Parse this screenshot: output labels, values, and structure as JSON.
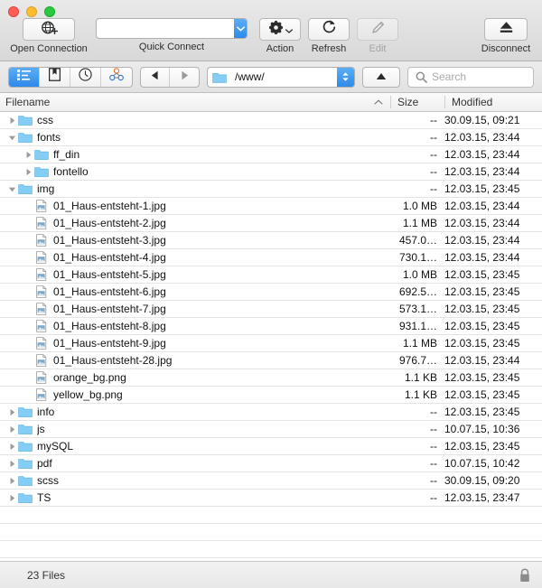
{
  "window": {
    "traffic_lights": [
      "close",
      "minimize",
      "zoom"
    ]
  },
  "toolbar": {
    "open_connection": {
      "label": "Open Connection",
      "icon": "globe-plus-icon"
    },
    "quick_connect": {
      "label": "Quick Connect",
      "value": "",
      "placeholder": "",
      "icon": "chevron-down-icon"
    },
    "action": {
      "label": "Action",
      "icon": "gear-icon"
    },
    "refresh": {
      "label": "Refresh",
      "icon": "refresh-icon"
    },
    "edit": {
      "label": "Edit",
      "icon": "pencil-icon",
      "disabled": true
    },
    "disconnect": {
      "label": "Disconnect",
      "icon": "eject-icon"
    }
  },
  "navbar": {
    "segments": [
      {
        "name": "browser-view",
        "icon": "list-view-icon",
        "selected": true
      },
      {
        "name": "bookmarks",
        "icon": "bookmark-icon",
        "selected": false
      },
      {
        "name": "history",
        "icon": "clock-icon",
        "selected": false
      },
      {
        "name": "bonjour",
        "icon": "bonjour-icon",
        "selected": false
      }
    ],
    "back": {
      "icon": "triangle-left-icon"
    },
    "forward": {
      "icon": "triangle-right-icon"
    },
    "path": {
      "value": "/www/",
      "icon": "folder-icon"
    },
    "up": {
      "icon": "triangle-up-icon"
    },
    "search": {
      "placeholder": "Search",
      "value": "",
      "icon": "search-icon"
    }
  },
  "columns": {
    "filename": "Filename",
    "size": "Size",
    "modified": "Modified",
    "sort_indicator": "▲"
  },
  "files": [
    {
      "name": "css",
      "type": "folder",
      "indent": 0,
      "expanded": false,
      "size": "--",
      "modified": "30.09.15, 09:21"
    },
    {
      "name": "fonts",
      "type": "folder",
      "indent": 0,
      "expanded": true,
      "size": "--",
      "modified": "12.03.15, 23:44"
    },
    {
      "name": "ff_din",
      "type": "folder",
      "indent": 1,
      "expanded": false,
      "size": "--",
      "modified": "12.03.15, 23:44"
    },
    {
      "name": "fontello",
      "type": "folder",
      "indent": 1,
      "expanded": false,
      "size": "--",
      "modified": "12.03.15, 23:44"
    },
    {
      "name": "img",
      "type": "folder",
      "indent": 0,
      "expanded": true,
      "size": "--",
      "modified": "12.03.15, 23:45"
    },
    {
      "name": "01_Haus-entsteht-1.jpg",
      "type": "image",
      "indent": 1,
      "expanded": null,
      "size": "1.0 MB",
      "modified": "12.03.15, 23:44"
    },
    {
      "name": "01_Haus-entsteht-2.jpg",
      "type": "image",
      "indent": 1,
      "expanded": null,
      "size": "1.1 MB",
      "modified": "12.03.15, 23:44"
    },
    {
      "name": "01_Haus-entsteht-3.jpg",
      "type": "image",
      "indent": 1,
      "expanded": null,
      "size": "457.0…",
      "modified": "12.03.15, 23:44"
    },
    {
      "name": "01_Haus-entsteht-4.jpg",
      "type": "image",
      "indent": 1,
      "expanded": null,
      "size": "730.1…",
      "modified": "12.03.15, 23:44"
    },
    {
      "name": "01_Haus-entsteht-5.jpg",
      "type": "image",
      "indent": 1,
      "expanded": null,
      "size": "1.0 MB",
      "modified": "12.03.15, 23:45"
    },
    {
      "name": "01_Haus-entsteht-6.jpg",
      "type": "image",
      "indent": 1,
      "expanded": null,
      "size": "692.5…",
      "modified": "12.03.15, 23:45"
    },
    {
      "name": "01_Haus-entsteht-7.jpg",
      "type": "image",
      "indent": 1,
      "expanded": null,
      "size": "573.1…",
      "modified": "12.03.15, 23:45"
    },
    {
      "name": "01_Haus-entsteht-8.jpg",
      "type": "image",
      "indent": 1,
      "expanded": null,
      "size": "931.1…",
      "modified": "12.03.15, 23:45"
    },
    {
      "name": "01_Haus-entsteht-9.jpg",
      "type": "image",
      "indent": 1,
      "expanded": null,
      "size": "1.1 MB",
      "modified": "12.03.15, 23:45"
    },
    {
      "name": "01_Haus-entsteht-28.jpg",
      "type": "image",
      "indent": 1,
      "expanded": null,
      "size": "976.7…",
      "modified": "12.03.15, 23:44"
    },
    {
      "name": "orange_bg.png",
      "type": "image",
      "indent": 1,
      "expanded": null,
      "size": "1.1 KB",
      "modified": "12.03.15, 23:45"
    },
    {
      "name": "yellow_bg.png",
      "type": "image",
      "indent": 1,
      "expanded": null,
      "size": "1.1 KB",
      "modified": "12.03.15, 23:45"
    },
    {
      "name": "info",
      "type": "folder",
      "indent": 0,
      "expanded": false,
      "size": "--",
      "modified": "12.03.15, 23:45"
    },
    {
      "name": "js",
      "type": "folder",
      "indent": 0,
      "expanded": false,
      "size": "--",
      "modified": "10.07.15, 10:36"
    },
    {
      "name": "mySQL",
      "type": "folder",
      "indent": 0,
      "expanded": false,
      "size": "--",
      "modified": "12.03.15, 23:45"
    },
    {
      "name": "pdf",
      "type": "folder",
      "indent": 0,
      "expanded": false,
      "size": "--",
      "modified": "10.07.15, 10:42"
    },
    {
      "name": "scss",
      "type": "folder",
      "indent": 0,
      "expanded": false,
      "size": "--",
      "modified": "30.09.15, 09:20"
    },
    {
      "name": "TS",
      "type": "folder",
      "indent": 0,
      "expanded": false,
      "size": "--",
      "modified": "12.03.15, 23:47"
    }
  ],
  "empty_rows": 4,
  "statusbar": {
    "text": "23 Files",
    "lock_icon": "lock-icon"
  },
  "colors": {
    "accent": "#2f8ae8",
    "folder": "#84cdf5",
    "row_separator": "#e4e4e4"
  }
}
